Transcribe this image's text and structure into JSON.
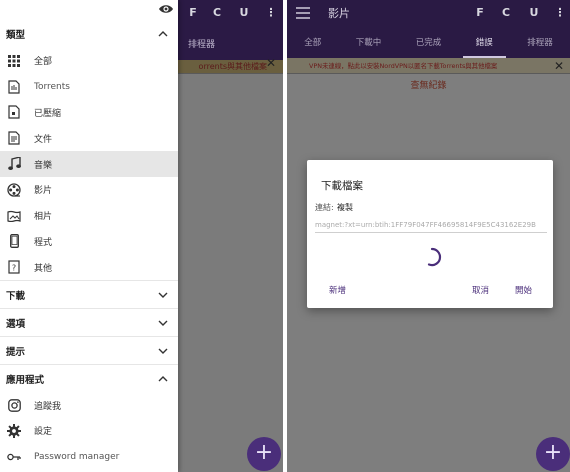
{
  "left": {
    "background": {
      "warning_fragment": "orrents與其他檔案",
      "tab_fragment": "排程器",
      "toolbar_icons": [
        "F",
        "C",
        "U"
      ]
    },
    "sections": [
      {
        "label": "類型",
        "expanded": true,
        "items": [
          {
            "label": "全部",
            "icon": "grid-icon"
          },
          {
            "label": "Torrents",
            "icon": "torrent-file-icon"
          },
          {
            "label": "已壓縮",
            "icon": "archive-icon"
          },
          {
            "label": "文件",
            "icon": "document-icon"
          },
          {
            "label": "音樂",
            "icon": "music-note-icon",
            "active": true
          },
          {
            "label": "影片",
            "icon": "film-reel-icon"
          },
          {
            "label": "相片",
            "icon": "image-icon"
          },
          {
            "label": "程式",
            "icon": "phone-icon"
          },
          {
            "label": "其他",
            "icon": "question-file-icon"
          }
        ]
      },
      {
        "label": "下載",
        "expanded": false
      },
      {
        "label": "選項",
        "expanded": false
      },
      {
        "label": "提示",
        "expanded": false
      },
      {
        "label": "應用程式",
        "expanded": true,
        "items": [
          {
            "label": "追蹤我",
            "icon": "instagram-icon"
          },
          {
            "label": "設定",
            "icon": "gear-icon"
          },
          {
            "label": "Password manager",
            "icon": "key-icon"
          }
        ]
      }
    ],
    "fab": "+"
  },
  "right": {
    "title": "影片",
    "tabs": [
      {
        "label": "全部"
      },
      {
        "label": "下載中"
      },
      {
        "label": "已完成"
      },
      {
        "label": "錯誤",
        "active": true
      },
      {
        "label": "排程器"
      }
    ],
    "warning": "VPN未連線，點此以安裝NordVPN以匿名下載Torrents與其他檔案",
    "empty_text": "查無紀錄",
    "fab": "+",
    "dialog": {
      "title": "下載檔案",
      "link_label": "連結:",
      "link_value": "複製",
      "magnet": "magnet:?xt=urn:btih:1FF79F047FF46695814F9E5C43162E29B",
      "buttons": {
        "new": "新增",
        "cancel": "取消",
        "start": "開始"
      }
    }
  },
  "colors": {
    "toolbar": "#2a1a44",
    "accent": "#4a2e7a",
    "warning_text": "#6a1a1a"
  }
}
